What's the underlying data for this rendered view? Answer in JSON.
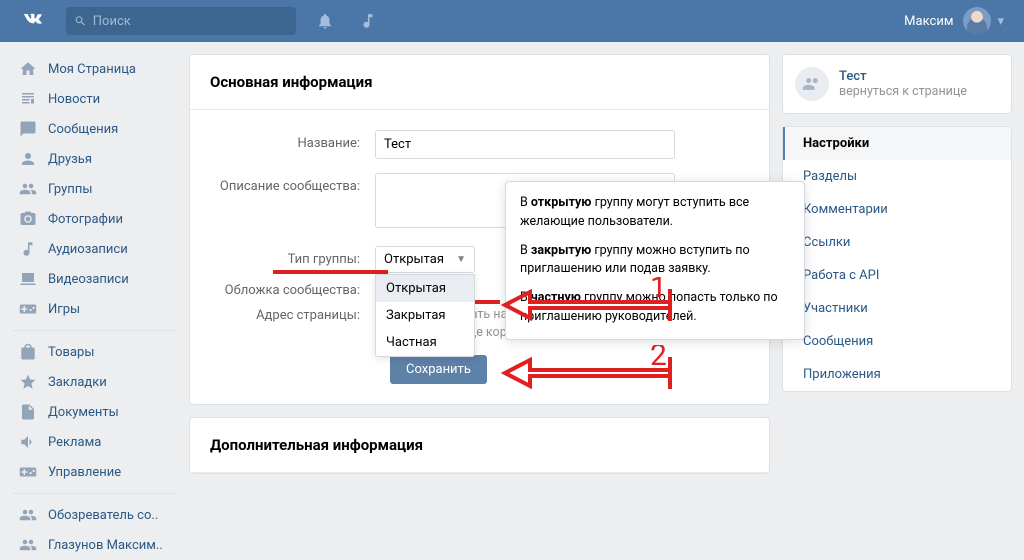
{
  "header": {
    "search_placeholder": "Поиск",
    "username": "Максим"
  },
  "sidebar": {
    "items": [
      {
        "label": "Моя Страница",
        "icon": "home"
      },
      {
        "label": "Новости",
        "icon": "news"
      },
      {
        "label": "Сообщения",
        "icon": "chat"
      },
      {
        "label": "Друзья",
        "icon": "user"
      },
      {
        "label": "Группы",
        "icon": "users"
      },
      {
        "label": "Фотографии",
        "icon": "camera"
      },
      {
        "label": "Аудиозаписи",
        "icon": "music"
      },
      {
        "label": "Видеозаписи",
        "icon": "video"
      },
      {
        "label": "Игры",
        "icon": "game"
      }
    ],
    "items2": [
      {
        "label": "Товары",
        "icon": "shop"
      },
      {
        "label": "Закладки",
        "icon": "star"
      },
      {
        "label": "Документы",
        "icon": "doc"
      },
      {
        "label": "Реклама",
        "icon": "ad"
      },
      {
        "label": "Управление",
        "icon": "game"
      }
    ],
    "items3": [
      {
        "label": "Обозреватель со..",
        "icon": "users"
      },
      {
        "label": "Глазунов Максим..",
        "icon": "users"
      }
    ]
  },
  "main": {
    "section_title": "Основная информация",
    "name_label": "Название:",
    "name_value": "Тест",
    "description_label": "Описание сообщества:",
    "type_label": "Тип группы:",
    "type_selected": "Открытая",
    "type_options": [
      "Открытая",
      "Закрытая",
      "Частная"
    ],
    "cover_label": "Обложка сообщества:",
    "address_label": "Адрес страницы:",
    "address_help": "Вы можете создать наклейки для Вашего сообщества, добавив странице короткий адрес.",
    "save_label": "Сохранить",
    "section2_title": "Дополнительная информация",
    "tooltip": {
      "p1_pre": "В ",
      "p1_bold": "открытую",
      "p1_post": " группу могут вступить все желающие пользователи.",
      "p2_pre": "В ",
      "p2_bold": "закрытую",
      "p2_post": " группу можно вступить по приглашению или подав заявку.",
      "p3_pre": "В ",
      "p3_bold": "частную",
      "p3_post": " группу можно попасть только по приглашению руководителей."
    }
  },
  "right": {
    "group_name": "Тест",
    "group_back": "вернуться к странице",
    "menu": [
      {
        "label": "Настройки",
        "active": true
      },
      {
        "label": "Разделы"
      },
      {
        "label": "Комментарии"
      },
      {
        "label": "Ссылки"
      },
      {
        "label": "Работа с API"
      },
      {
        "label": "Участники"
      },
      {
        "label": "Сообщения"
      },
      {
        "label": "Приложения"
      }
    ]
  },
  "annotations": {
    "arrow1": "1",
    "arrow2": "2"
  }
}
